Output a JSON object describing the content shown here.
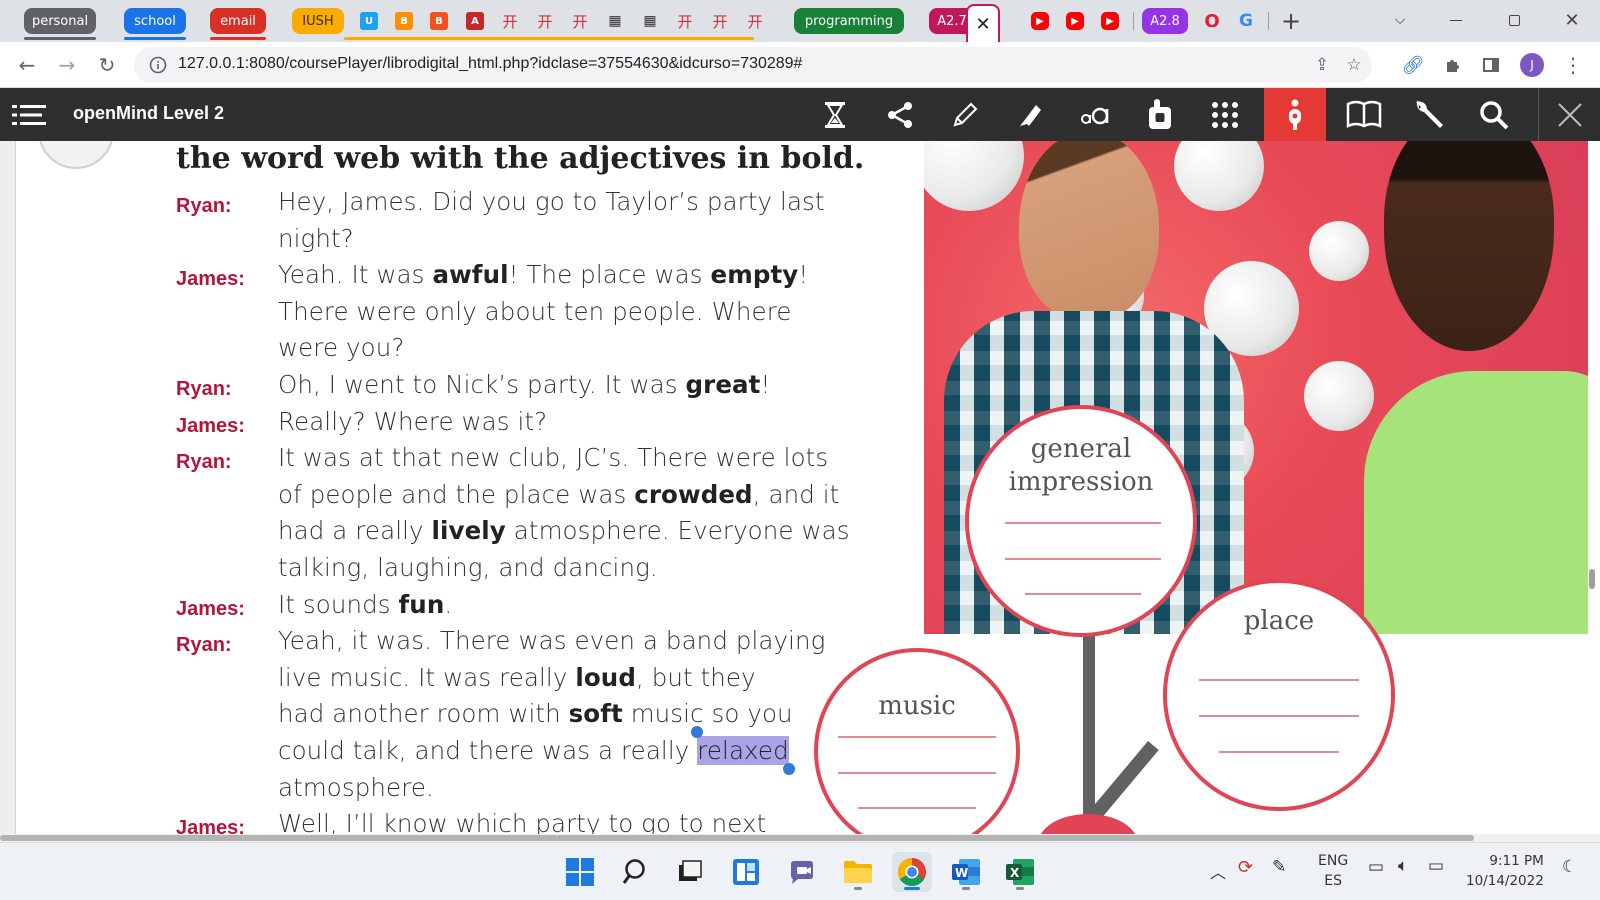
{
  "browser": {
    "tab_groups": [
      {
        "label": "personal",
        "color": "#5f6368"
      },
      {
        "label": "school",
        "color": "#1a73e8"
      },
      {
        "label": "email",
        "color": "#d93025"
      },
      {
        "label": "IUSH",
        "color": "#f9ab00"
      },
      {
        "label": "programming",
        "color": "#188038"
      },
      {
        "label": "A2.7",
        "color": "#c2185b"
      },
      {
        "label": "A2.8",
        "color": "#9334e6"
      }
    ],
    "close_tab_symbol": "✕",
    "new_tab_symbol": "+",
    "url": "127.0.0.1:8080/coursePlayer/librodigital_html.php?idclase=37554630&idcurso=730289#",
    "profile_initial": "J"
  },
  "app": {
    "title": "openMind Level 2",
    "accent_color": "#e53935"
  },
  "lesson": {
    "instruction": "the word web with the adjectives in bold.",
    "selected_word": "relaxed",
    "dialogue": [
      {
        "speaker": "Ryan:",
        "lines": [
          [
            "Hey, James. Did you go to Taylor’s party last"
          ],
          [
            "night?"
          ]
        ]
      },
      {
        "speaker": "James:",
        "lines": [
          [
            "Yeah. It was ",
            {
              "b": "awful"
            },
            "! The place was ",
            {
              "b": "empty"
            },
            "!"
          ],
          [
            "There were only about ten people. Where"
          ],
          [
            "were you?"
          ]
        ]
      },
      {
        "speaker": "Ryan:",
        "lines": [
          [
            "Oh, I went to Nick’s party. It was ",
            {
              "b": "great"
            },
            "!"
          ]
        ]
      },
      {
        "speaker": "James:",
        "lines": [
          [
            "Really? Where was it?"
          ]
        ]
      },
      {
        "speaker": "Ryan:",
        "lines": [
          [
            "It was at that new club, JC’s. There were lots"
          ],
          [
            "of people and the place was ",
            {
              "b": "crowded"
            },
            ", and it"
          ],
          [
            "had a really ",
            {
              "b": "lively"
            },
            " atmosphere. Everyone was"
          ],
          [
            "talking, laughing, and dancing."
          ]
        ]
      },
      {
        "speaker": "James:",
        "lines": [
          [
            "It sounds ",
            {
              "b": "fun"
            },
            "."
          ]
        ]
      },
      {
        "speaker": "Ryan:",
        "lines": [
          [
            "Yeah, it was. There was even a band playing"
          ],
          [
            "live music. It was really ",
            {
              "b": "loud"
            },
            ", but they"
          ],
          [
            "had another room with ",
            {
              "b": "soft"
            },
            " music so you"
          ],
          [
            "could talk, and there was a really ",
            {
              "sel": "relaxed"
            }
          ],
          [
            "atmosphere."
          ]
        ]
      },
      {
        "speaker": "James:",
        "lines": [
          [
            "Well, I’ll know which party to go to next"
          ]
        ]
      }
    ],
    "word_web": {
      "general_impression": "general\nimpression",
      "place": "place",
      "music": "music"
    }
  },
  "taskbar": {
    "language": "ENG",
    "layout": "ES",
    "time": "9:11 PM",
    "date": "10/14/2022"
  }
}
